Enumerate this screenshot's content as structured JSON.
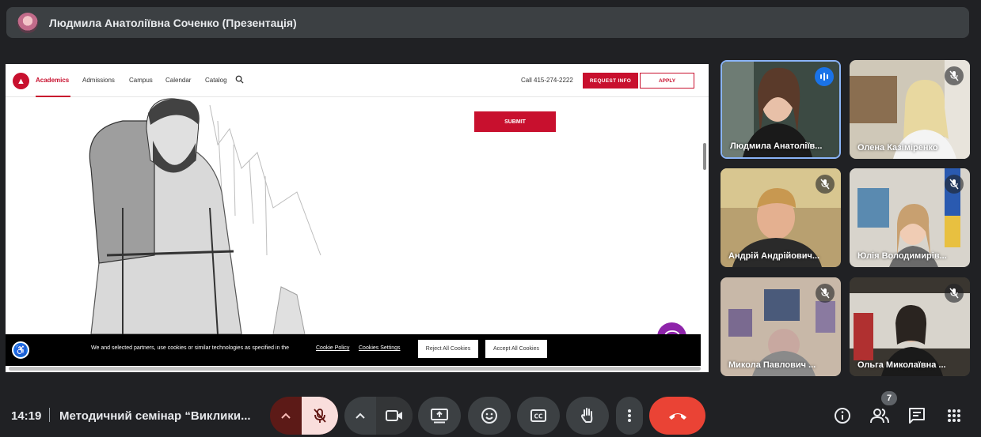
{
  "presenter_bar": {
    "title": "Людмила Анатоліївна Соченко (Презентація)"
  },
  "shared_site": {
    "nav": [
      "Academics",
      "Admissions",
      "Campus",
      "Calendar",
      "Catalog"
    ],
    "call": "Call 415-274-2222",
    "request_info": "REQUEST INFO",
    "apply": "APPLY",
    "submit": "SUBMIT",
    "cookie_text": "We and selected partners, use cookies or similar technologies as specified in the",
    "cookie_policy": "Cookie Policy",
    "cookie_settings": "Cookies Settings",
    "reject": "Reject All Cookies",
    "accept": "Accept All Cookies"
  },
  "participants": [
    {
      "name": "Людмила Анатоліїв..."
    },
    {
      "name": "Олена Казіміренко"
    },
    {
      "name": "Андрій Андрійович..."
    },
    {
      "name": "Юлія Володимирів..."
    },
    {
      "name": "Микола Павлович ..."
    },
    {
      "name": "Ольга Миколаївна ..."
    }
  ],
  "bottom_bar": {
    "time": "14:19",
    "meeting_title": "Методичний семінар “Виклики...",
    "people_count": "7"
  },
  "colors": {
    "accent_red": "#ea4335",
    "site_red": "#c8102e",
    "chat_purple": "#8e24aa",
    "speaking_blue": "#8ab4f8"
  }
}
